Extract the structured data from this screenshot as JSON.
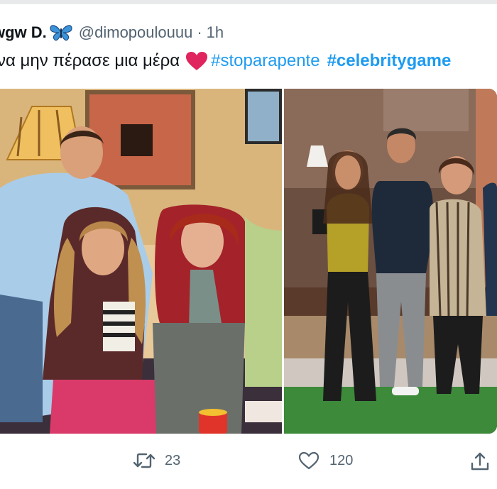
{
  "tweet": {
    "display_name": "wgw D.",
    "display_name_icon": "butterfly-emoji",
    "handle": "@dimopoulouuu",
    "separator": "·",
    "time": "1h",
    "text": "να μην πέρασε μια μέρα",
    "emoji": "red-heart-emoji",
    "hashtags": [
      "#stoparapente",
      "#celebritygame"
    ],
    "link_color": "#1d9bf0"
  },
  "media": {
    "left_photo": "group-photo-old",
    "right_photo": "group-photo-new"
  },
  "actions": {
    "retweet": {
      "icon": "retweet-icon",
      "count": "23"
    },
    "like": {
      "icon": "heart-icon",
      "count": "120"
    },
    "share": {
      "icon": "share-icon"
    }
  }
}
